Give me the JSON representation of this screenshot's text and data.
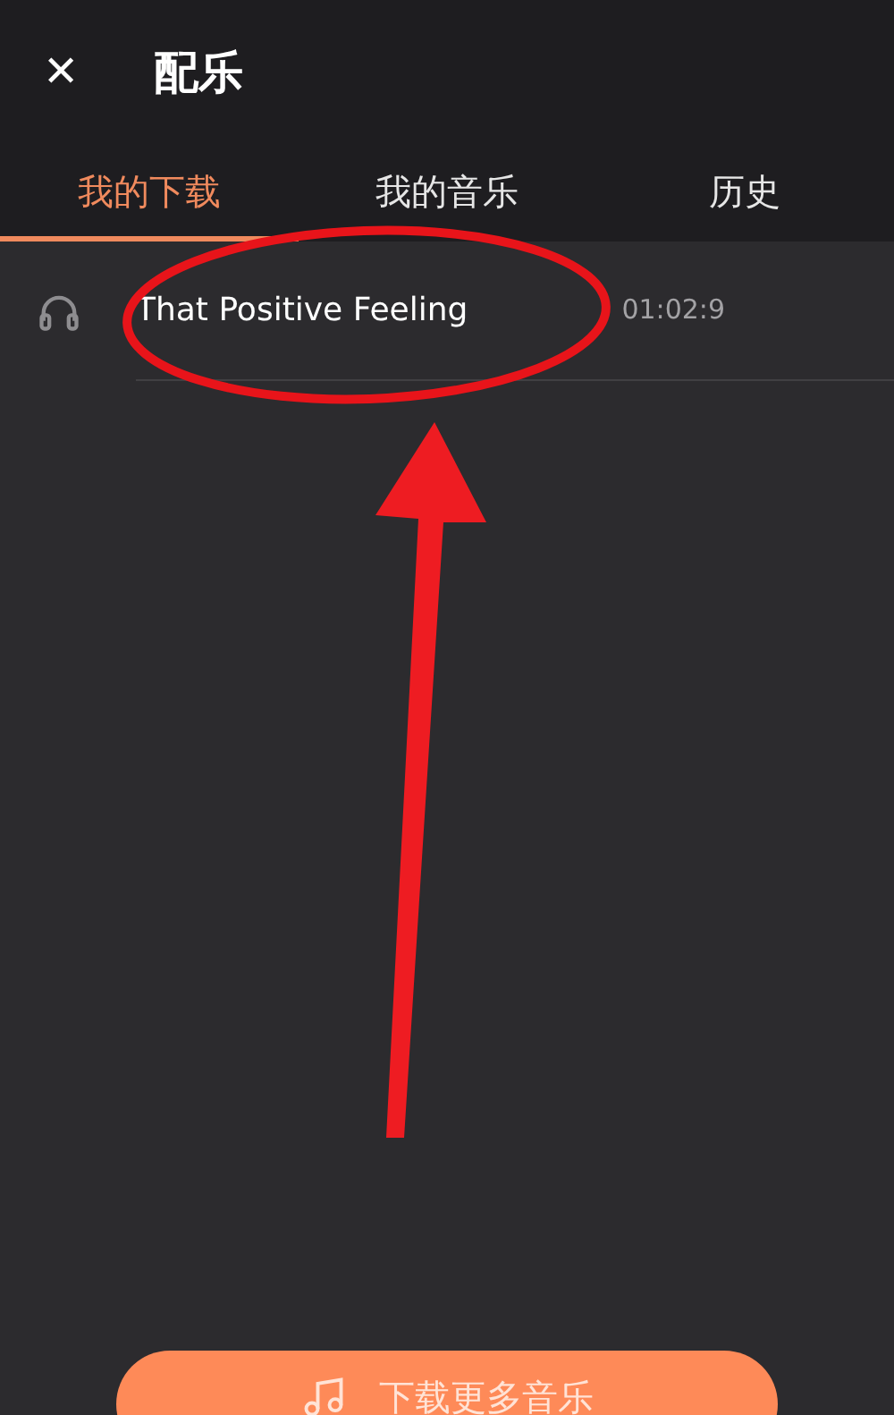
{
  "header": {
    "close": "✕",
    "title": "配乐"
  },
  "tabs": [
    {
      "label": "我的下载",
      "selected": true
    },
    {
      "label": "我的音乐",
      "selected": false
    },
    {
      "label": "历史",
      "selected": false
    }
  ],
  "tracks": [
    {
      "title": "That Positive Feeling",
      "duration": "01:02:9"
    }
  ],
  "download_button": {
    "label": "下载更多音乐"
  }
}
